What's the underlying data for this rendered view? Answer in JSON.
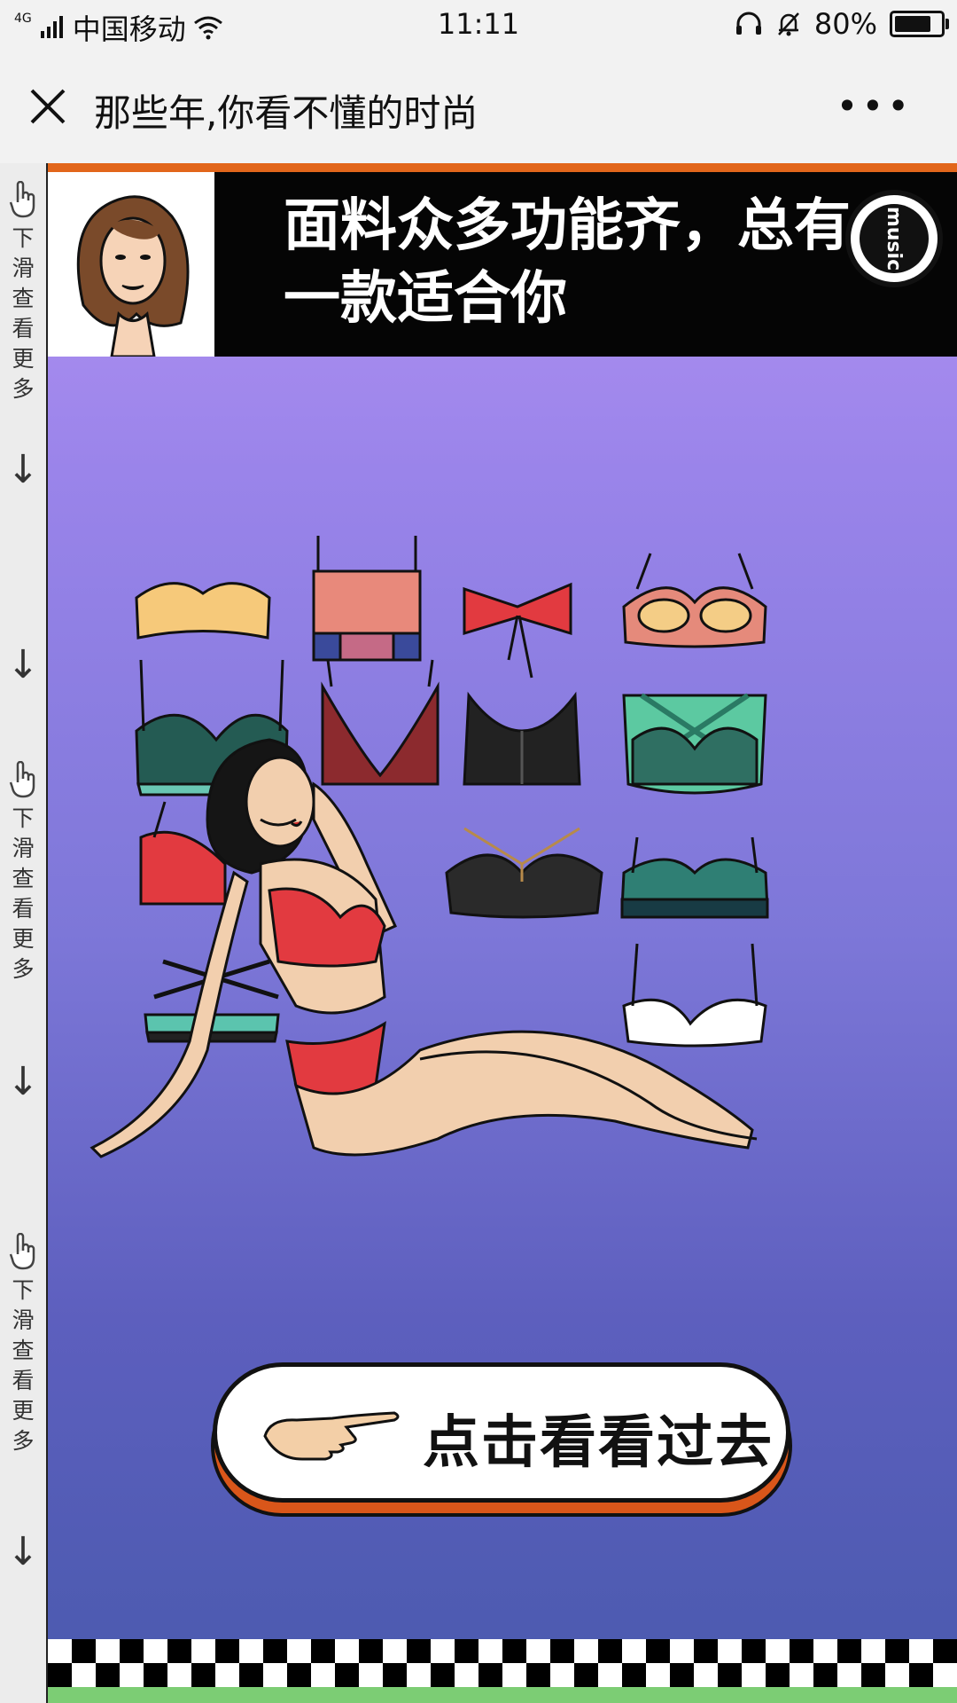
{
  "status_bar": {
    "network_type": "4G",
    "carrier": "中国移动",
    "time": "11:11",
    "battery_percent": "80%",
    "battery_level": 0.8
  },
  "nav": {
    "title": "那些年,你看不懂的时尚",
    "more_label": "•••"
  },
  "rail": {
    "hint_text": "下滑查看更多",
    "arrow": "↓"
  },
  "banner": {
    "headline_line1": "面料众多功能齐，总有",
    "headline_line2": "一款适合你",
    "badge_text": "music"
  },
  "cta": {
    "label": "点击看看过去"
  },
  "colors": {
    "accent_orange": "#e2661b",
    "bg_purple_top": "#b493f3",
    "bg_purple_bottom": "#4a5aae",
    "checker_green": "#7ccd74"
  }
}
